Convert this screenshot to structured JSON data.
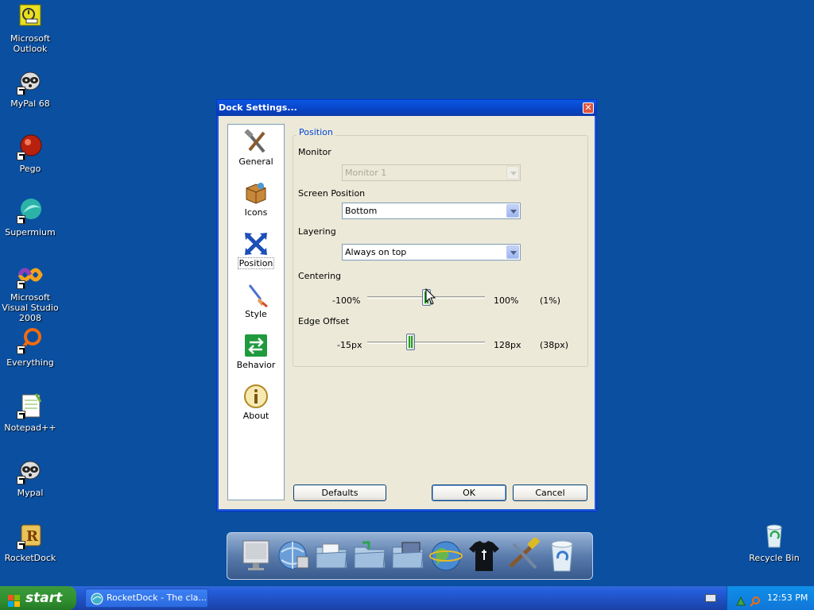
{
  "desktop": {
    "icons": [
      {
        "label": "Microsoft Outlook"
      },
      {
        "label": "MyPal 68"
      },
      {
        "label": "Pego"
      },
      {
        "label": "Supermium"
      },
      {
        "label": "Microsoft Visual Studio 2008"
      },
      {
        "label": "Everything"
      },
      {
        "label": "Notepad++"
      },
      {
        "label": "Mypal"
      },
      {
        "label": "RocketDock"
      },
      {
        "label": "Recycle Bin"
      }
    ]
  },
  "dialog": {
    "title": "Dock Settings...",
    "close_glyph": "✕",
    "nav": [
      {
        "label": "General",
        "icon": "tools-icon"
      },
      {
        "label": "Icons",
        "icon": "box-icon"
      },
      {
        "label": "Position",
        "icon": "arrows-icon",
        "active": true
      },
      {
        "label": "Style",
        "icon": "brush-icon"
      },
      {
        "label": "Behavior",
        "icon": "behavior-icon"
      },
      {
        "label": "About",
        "icon": "info-icon"
      }
    ],
    "group_title": "Position",
    "monitor": {
      "label": "Monitor",
      "value": "Monitor 1",
      "disabled": true
    },
    "screen_position": {
      "label": "Screen Position",
      "value": "Bottom"
    },
    "layering": {
      "label": "Layering",
      "value": "Always on top"
    },
    "centering": {
      "label": "Centering",
      "min": "-100%",
      "max": "100%",
      "value_text": "(1%)",
      "value": 1
    },
    "edge_offset": {
      "label": "Edge Offset",
      "min": "-15px",
      "max": "128px",
      "value_text": "(38px)",
      "value": 38
    },
    "buttons": {
      "defaults": "Defaults",
      "ok": "OK",
      "cancel": "Cancel"
    }
  },
  "dock": {
    "items": [
      "monitor-icon",
      "globe-network-icon",
      "folder-documents-icon",
      "folder-refresh-icon",
      "folder-pictures-icon",
      "internet-globe-icon",
      "tshirt-icon",
      "tools-icon",
      "recycle-bin-icon"
    ]
  },
  "taskbar": {
    "start_label": "start",
    "task_label": "RocketDock - The cla...",
    "clock": "12:53 PM"
  }
}
